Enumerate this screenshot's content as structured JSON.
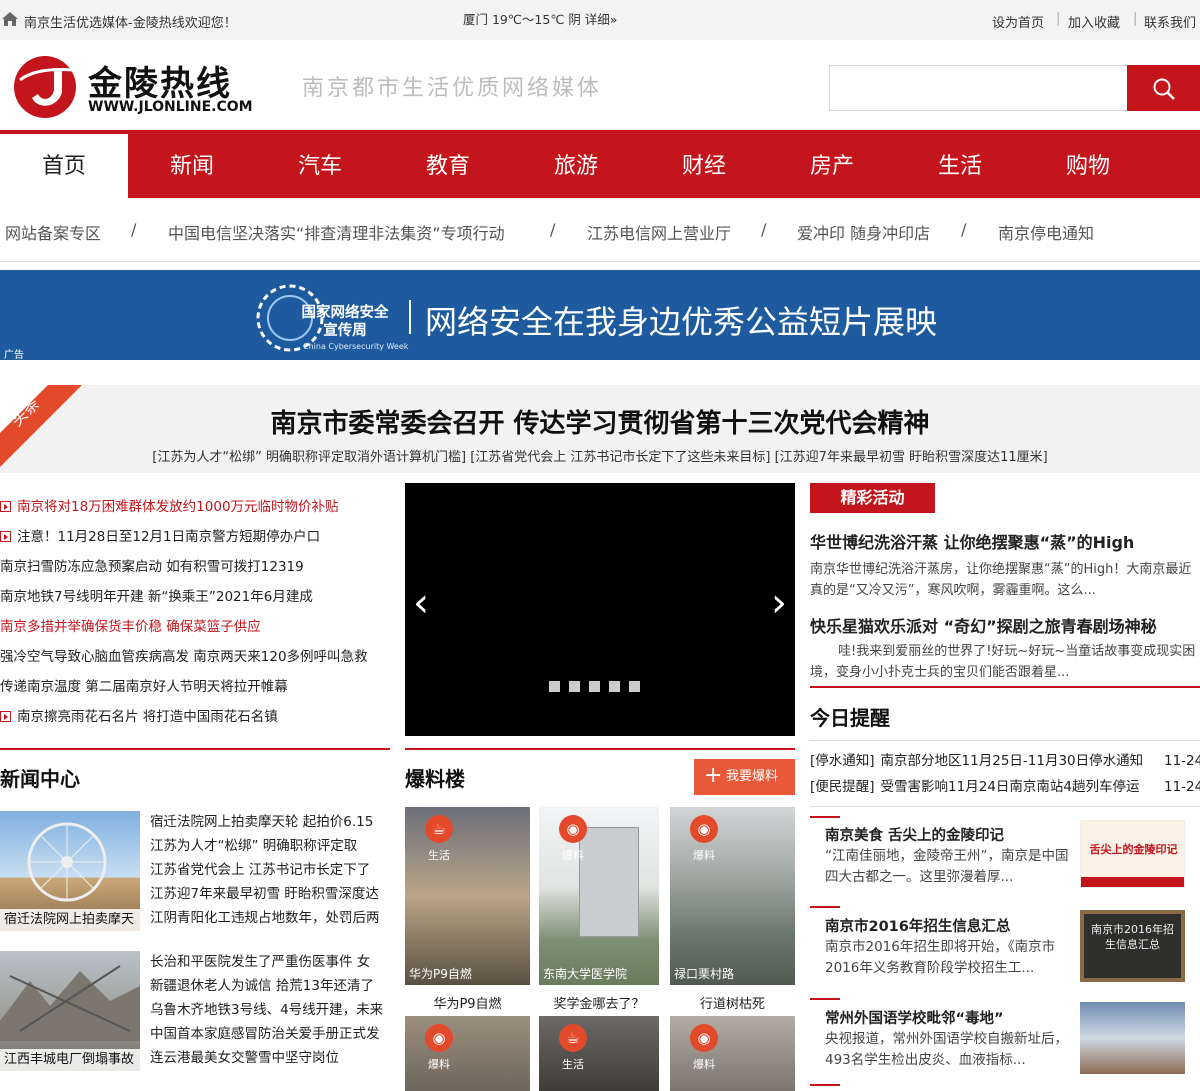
{
  "topbar": {
    "welcome": "南京生活优选媒体-金陵热线欢迎您！",
    "weather": "厦门 19℃～15℃ 阴 详细»",
    "links": [
      "设为首页",
      "加入收藏",
      "联系我们"
    ]
  },
  "brand": {
    "name_cn": "金陵热线",
    "domain": "WWW.JLONLINE.COM",
    "slogan": "南京都市生活优质网络媒体",
    "search_placeholder": ""
  },
  "nav": [
    "首页",
    "新闻",
    "汽车",
    "教育",
    "旅游",
    "财经",
    "房产",
    "生活",
    "购物"
  ],
  "quick_links": [
    "网站备案专区",
    "中国电信坚决落实“排查清理非法集资”专项行动",
    "江苏电信网上营业厅",
    "爱冲印 随身冲印店",
    "南京停电通知"
  ],
  "quick_sep": "/",
  "banner": {
    "logo_title": "国家网络安全\n宣传周",
    "logo_sub": "China Cybersecurity Week",
    "text": "网络安全在我身边优秀公益短片展映",
    "ad": "广告"
  },
  "headline": {
    "tag": "头条",
    "title": "南京市委常委会召开 传达学习贯彻省第十三次党代会精神",
    "subs": [
      "[江苏为人才“松绑” 明确职称评定取消外语计算机门槛]",
      "[江苏省党代会上 江苏书记市长定下了这些未来目标]",
      "[江苏迎7年来最早初雪 盱眙积雪深度达11厘米]"
    ]
  },
  "news_list": [
    {
      "text": "南京将对18万困难群体发放约1000万元临时物价补贴",
      "red": true,
      "arrow": true
    },
    {
      "text": "注意！11月28日至12月1日南京警方短期停办户口",
      "red": false,
      "arrow": true
    },
    {
      "text": "南京扫雪防冻应急预案启动 如有积雪可拨打12319",
      "red": false,
      "arrow": false
    },
    {
      "text": "南京地铁7号线明年开建 新“换乘王”2021年6月建成",
      "red": false,
      "arrow": false
    },
    {
      "text": "南京多措并举确保货丰价稳 确保菜篮子供应",
      "red": true,
      "arrow": false
    },
    {
      "text": "强冷空气导致心脑血管疾病高发 南京两天来120多例呼叫急救",
      "red": false,
      "arrow": false
    },
    {
      "text": "传递南京温度 第二届南京好人节明天将拉开帷幕",
      "red": false,
      "arrow": false
    },
    {
      "text": "南京擦亮雨花石名片 将打造中国雨花石名镇",
      "red": false,
      "arrow": true
    }
  ],
  "slider": {
    "prev": "‹",
    "next": "›",
    "dots": 5
  },
  "activities": {
    "tag": "精彩活动",
    "items": [
      {
        "title": "华世博纪洗浴汗蒸 让你绝摆聚惠“蒸”的High",
        "desc": "南京华世博纪洗浴汗蒸房，让你绝摆聚惠“蒸”的High！大南京最近真的是“又冷又污”，寒风吹啊，雾霾重啊。这么..."
      },
      {
        "title": "快乐星猫欢乐派对 “奇幻”探剧之旅青春剧场神秘",
        "desc": "哇!我来到爱丽丝的世界了!好玩~好玩~当童话故事变成现实困境，变身小小扑克士兵的宝贝们能否跟着星..."
      }
    ]
  },
  "today": {
    "title": "今日提醒",
    "rows": [
      {
        "tag": "[停水通知]",
        "text": "南京部分地区11月25日-11月30日停水通知",
        "date": "11-24"
      },
      {
        "tag": "[便民提醒]",
        "text": "受雪害影响11月24日南京南站4趟列车停运",
        "date": "11-24"
      }
    ],
    "cards": [
      {
        "title": "南京美食 舌尖上的金陵印记",
        "desc": "“江南佳丽地，金陵帝王州”，南京是中国四大古都之一。这里弥漫着厚..."
      },
      {
        "title": "南京市2016年招生信息汇总",
        "desc": "南京市2016年招生即将开始，《南京市2016年义务教育阶段学校招生工..."
      },
      {
        "title": "常州外国语学校毗邻“毒地”",
        "desc": "央视报道，常州外国语学校自搬新址后，493名学生检出皮炎、血液指标..."
      }
    ],
    "card_img_texts": [
      "舌尖上的金陵印记",
      "南京市2016年招生信息汇总",
      ""
    ]
  },
  "news_center": {
    "title": "新闻中心",
    "blocks": [
      {
        "caption": "宿迁法院网上拍卖摩天",
        "lines": [
          "宿迁法院网上拍卖摩天轮 起拍价6.15",
          "江苏为人才“松绑” 明确职称评定取",
          "江苏省党代会上 江苏书记市长定下了",
          "江苏迎7年来最早初雪 盱眙积雪深度达",
          "江阴青阳化工违规占地数年，处罚后两"
        ]
      },
      {
        "caption": "江西丰城电厂倒塌事故",
        "lines": [
          "长治和平医院发生了严重伤医事件 女",
          "新疆退休老人为诚信 拾荒13年还清了",
          "乌鲁木齐地铁3号线、4号线开建，未来",
          "中国首本家庭感冒防治关爱手册正式发",
          "连云港最美女交警雪中坚守岗位"
        ]
      }
    ]
  },
  "baoliao": {
    "title": "爆料楼",
    "button": "我要爆料",
    "items": [
      {
        "badge": "生活",
        "caption": "华为P9自燃",
        "label": "华为P9自燃"
      },
      {
        "badge": "爆料",
        "caption": "东南大学医学院",
        "label": "奖学金哪去了？"
      },
      {
        "badge": "爆料",
        "caption": "禄口栗村路",
        "label": "行道树枯死"
      },
      {
        "badge": "爆料",
        "caption": "",
        "label": ""
      },
      {
        "badge": "生活",
        "caption": "",
        "label": ""
      },
      {
        "badge": "爆料",
        "caption": "",
        "label": ""
      }
    ]
  },
  "colors": {
    "brand_red": "#c4141c",
    "banner_blue": "#1d5b9e",
    "accent_orange": "#e34a2c"
  }
}
